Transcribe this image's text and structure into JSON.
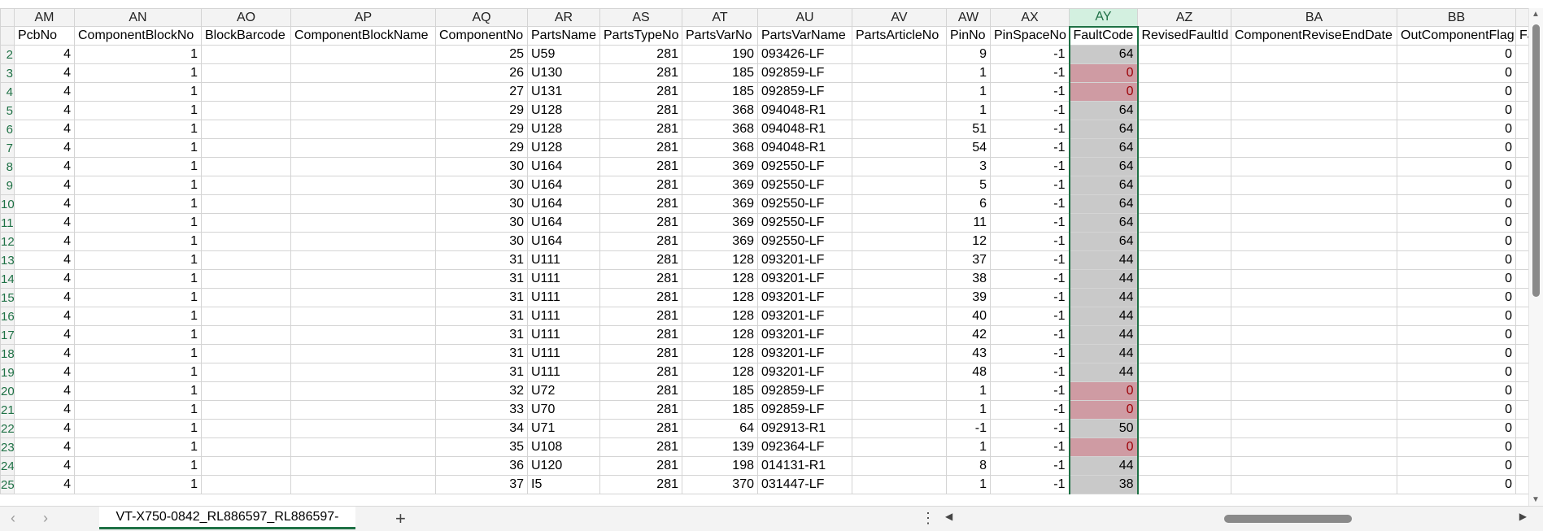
{
  "columns": [
    {
      "letter": "AM",
      "header": "PcbNo",
      "type": "num"
    },
    {
      "letter": "AN",
      "header": "ComponentBlockNo",
      "type": "num"
    },
    {
      "letter": "AO",
      "header": "BlockBarcode",
      "type": "txt"
    },
    {
      "letter": "AP",
      "header": "ComponentBlockName",
      "type": "txt"
    },
    {
      "letter": "AQ",
      "header": "ComponentNo",
      "type": "num"
    },
    {
      "letter": "AR",
      "header": "PartsName",
      "type": "txt"
    },
    {
      "letter": "AS",
      "header": "PartsTypeNo",
      "type": "num"
    },
    {
      "letter": "AT",
      "header": "PartsVarNo",
      "type": "num"
    },
    {
      "letter": "AU",
      "header": "PartsVarName",
      "type": "txt"
    },
    {
      "letter": "AV",
      "header": "PartsArticleNo",
      "type": "txt"
    },
    {
      "letter": "AW",
      "header": "PinNo",
      "type": "num"
    },
    {
      "letter": "AX",
      "header": "PinSpaceNo",
      "type": "num"
    },
    {
      "letter": "AY",
      "header": "FaultCode",
      "type": "fault"
    },
    {
      "letter": "AZ",
      "header": "RevisedFaultId",
      "type": "txt"
    },
    {
      "letter": "BA",
      "header": "ComponentReviseEndDate",
      "type": "txt"
    },
    {
      "letter": "BB",
      "header": "OutComponentFlag",
      "type": "num"
    },
    {
      "letter": "",
      "header": "Fau",
      "type": "txt"
    }
  ],
  "rows": [
    {
      "n": "2",
      "c": [
        "4",
        "1",
        "",
        "",
        "25",
        "U59",
        "281",
        "190",
        "093426-LF",
        "",
        "9",
        "-1",
        "64",
        "",
        "",
        "0",
        ""
      ]
    },
    {
      "n": "3",
      "c": [
        "4",
        "1",
        "",
        "",
        "26",
        "U130",
        "281",
        "185",
        "092859-LF",
        "",
        "1",
        "-1",
        "0",
        "",
        "",
        "0",
        ""
      ]
    },
    {
      "n": "4",
      "c": [
        "4",
        "1",
        "",
        "",
        "27",
        "U131",
        "281",
        "185",
        "092859-LF",
        "",
        "1",
        "-1",
        "0",
        "",
        "",
        "0",
        ""
      ]
    },
    {
      "n": "5",
      "c": [
        "4",
        "1",
        "",
        "",
        "29",
        "U128",
        "281",
        "368",
        "094048-R1",
        "",
        "1",
        "-1",
        "64",
        "",
        "",
        "0",
        ""
      ]
    },
    {
      "n": "6",
      "c": [
        "4",
        "1",
        "",
        "",
        "29",
        "U128",
        "281",
        "368",
        "094048-R1",
        "",
        "51",
        "-1",
        "64",
        "",
        "",
        "0",
        ""
      ]
    },
    {
      "n": "7",
      "c": [
        "4",
        "1",
        "",
        "",
        "29",
        "U128",
        "281",
        "368",
        "094048-R1",
        "",
        "54",
        "-1",
        "64",
        "",
        "",
        "0",
        ""
      ]
    },
    {
      "n": "8",
      "c": [
        "4",
        "1",
        "",
        "",
        "30",
        "U164",
        "281",
        "369",
        "092550-LF",
        "",
        "3",
        "-1",
        "64",
        "",
        "",
        "0",
        ""
      ]
    },
    {
      "n": "9",
      "c": [
        "4",
        "1",
        "",
        "",
        "30",
        "U164",
        "281",
        "369",
        "092550-LF",
        "",
        "5",
        "-1",
        "64",
        "",
        "",
        "0",
        ""
      ]
    },
    {
      "n": "10",
      "c": [
        "4",
        "1",
        "",
        "",
        "30",
        "U164",
        "281",
        "369",
        "092550-LF",
        "",
        "6",
        "-1",
        "64",
        "",
        "",
        "0",
        ""
      ]
    },
    {
      "n": "11",
      "c": [
        "4",
        "1",
        "",
        "",
        "30",
        "U164",
        "281",
        "369",
        "092550-LF",
        "",
        "11",
        "-1",
        "64",
        "",
        "",
        "0",
        ""
      ]
    },
    {
      "n": "12",
      "c": [
        "4",
        "1",
        "",
        "",
        "30",
        "U164",
        "281",
        "369",
        "092550-LF",
        "",
        "12",
        "-1",
        "64",
        "",
        "",
        "0",
        ""
      ]
    },
    {
      "n": "13",
      "c": [
        "4",
        "1",
        "",
        "",
        "31",
        "U111",
        "281",
        "128",
        "093201-LF",
        "",
        "37",
        "-1",
        "44",
        "",
        "",
        "0",
        ""
      ]
    },
    {
      "n": "14",
      "c": [
        "4",
        "1",
        "",
        "",
        "31",
        "U111",
        "281",
        "128",
        "093201-LF",
        "",
        "38",
        "-1",
        "44",
        "",
        "",
        "0",
        ""
      ]
    },
    {
      "n": "15",
      "c": [
        "4",
        "1",
        "",
        "",
        "31",
        "U111",
        "281",
        "128",
        "093201-LF",
        "",
        "39",
        "-1",
        "44",
        "",
        "",
        "0",
        ""
      ]
    },
    {
      "n": "16",
      "c": [
        "4",
        "1",
        "",
        "",
        "31",
        "U111",
        "281",
        "128",
        "093201-LF",
        "",
        "40",
        "-1",
        "44",
        "",
        "",
        "0",
        ""
      ]
    },
    {
      "n": "17",
      "c": [
        "4",
        "1",
        "",
        "",
        "31",
        "U111",
        "281",
        "128",
        "093201-LF",
        "",
        "42",
        "-1",
        "44",
        "",
        "",
        "0",
        ""
      ]
    },
    {
      "n": "18",
      "c": [
        "4",
        "1",
        "",
        "",
        "31",
        "U111",
        "281",
        "128",
        "093201-LF",
        "",
        "43",
        "-1",
        "44",
        "",
        "",
        "0",
        ""
      ]
    },
    {
      "n": "19",
      "c": [
        "4",
        "1",
        "",
        "",
        "31",
        "U111",
        "281",
        "128",
        "093201-LF",
        "",
        "48",
        "-1",
        "44",
        "",
        "",
        "0",
        ""
      ]
    },
    {
      "n": "20",
      "c": [
        "4",
        "1",
        "",
        "",
        "32",
        "U72",
        "281",
        "185",
        "092859-LF",
        "",
        "1",
        "-1",
        "0",
        "",
        "",
        "0",
        ""
      ]
    },
    {
      "n": "21",
      "c": [
        "4",
        "1",
        "",
        "",
        "33",
        "U70",
        "281",
        "185",
        "092859-LF",
        "",
        "1",
        "-1",
        "0",
        "",
        "",
        "0",
        ""
      ]
    },
    {
      "n": "22",
      "c": [
        "4",
        "1",
        "",
        "",
        "34",
        "U71",
        "281",
        "64",
        "092913-R1",
        "",
        "-1",
        "-1",
        "50",
        "",
        "",
        "0",
        ""
      ]
    },
    {
      "n": "23",
      "c": [
        "4",
        "1",
        "",
        "",
        "35",
        "U108",
        "281",
        "139",
        "092364-LF",
        "",
        "1",
        "-1",
        "0",
        "",
        "",
        "0",
        ""
      ]
    },
    {
      "n": "24",
      "c": [
        "4",
        "1",
        "",
        "",
        "36",
        "U120",
        "281",
        "198",
        "014131-R1",
        "",
        "8",
        "-1",
        "44",
        "",
        "",
        "0",
        ""
      ]
    },
    {
      "n": "25",
      "c": [
        "4",
        "1",
        "",
        "",
        "37",
        "I5",
        "281",
        "370",
        "031447-LF",
        "",
        "1",
        "-1",
        "38",
        "",
        "",
        "0",
        ""
      ]
    }
  ],
  "selected_column": "AY",
  "highlight_value": "0",
  "colors": {
    "highlight_bg": "#cf9ba3",
    "highlight_text": "#9c0006",
    "selected_bg": "#c9c9c9",
    "accent": "#1e7145"
  },
  "sheet_tab": {
    "label": "VT-X750-0842_RL886597_RL886597-"
  },
  "icons": {
    "prev_sheet": "chevron-left-icon",
    "next_sheet": "chevron-right-icon",
    "add_sheet": "plus-icon",
    "more": "vertical-dots-icon",
    "scroll_left": "triangle-left-icon",
    "scroll_right": "triangle-right-icon"
  },
  "glyphs": {
    "prev": "‹",
    "next": "›",
    "add": "+",
    "more": "⋮",
    "left": "◀",
    "right": "▶",
    "up": "▲",
    "down": "▼"
  }
}
